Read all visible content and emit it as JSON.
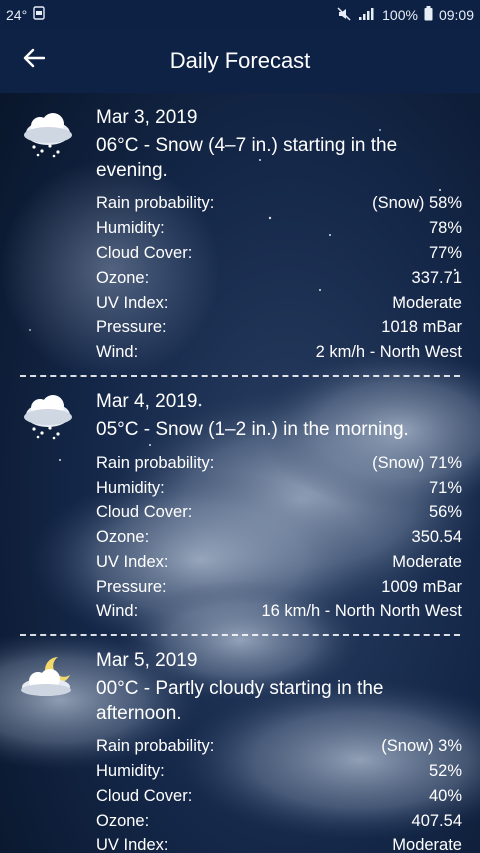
{
  "status_bar": {
    "temperature": "24°",
    "battery_percent": "100%",
    "time": "09:09",
    "icons": [
      "notification-icon",
      "mute-icon",
      "signal-icon",
      "battery-icon"
    ]
  },
  "app_bar": {
    "title": "Daily Forecast",
    "back_icon": "arrow-left-icon"
  },
  "days": [
    {
      "icon": "snow-cloud-icon",
      "date": "Mar 3, 2019",
      "summary": "06°C - Snow (4–7 in.) starting in the evening.",
      "details": [
        {
          "label": "Rain probability:",
          "value": "(Snow) 58%"
        },
        {
          "label": "Humidity:",
          "value": "78%"
        },
        {
          "label": "Cloud Cover:",
          "value": "77%"
        },
        {
          "label": "Ozone:",
          "value": "337.71"
        },
        {
          "label": "UV Index:",
          "value": "Moderate"
        },
        {
          "label": "Pressure:",
          "value": "1018 mBar"
        },
        {
          "label": "Wind:",
          "value": "2 km/h - North West"
        }
      ]
    },
    {
      "icon": "snow-cloud-icon",
      "date": "Mar 4, 2019",
      "summary": "05°C - Snow (1–2 in.) in the morning.",
      "details": [
        {
          "label": "Rain probability:",
          "value": "(Snow) 71%"
        },
        {
          "label": "Humidity:",
          "value": "71%"
        },
        {
          "label": "Cloud Cover:",
          "value": "56%"
        },
        {
          "label": "Ozone:",
          "value": "350.54"
        },
        {
          "label": "UV Index:",
          "value": "Moderate"
        },
        {
          "label": "Pressure:",
          "value": "1009 mBar"
        },
        {
          "label": "Wind:",
          "value": "16 km/h - North North West"
        }
      ]
    },
    {
      "icon": "partly-cloudy-night-icon",
      "date": "Mar 5, 2019",
      "summary": "00°C - Partly cloudy starting in the afternoon.",
      "details": [
        {
          "label": "Rain probability:",
          "value": "(Snow) 3%"
        },
        {
          "label": "Humidity:",
          "value": "52%"
        },
        {
          "label": "Cloud Cover:",
          "value": "40%"
        },
        {
          "label": "Ozone:",
          "value": "407.54"
        },
        {
          "label": "UV Index:",
          "value": "Moderate"
        }
      ]
    }
  ]
}
